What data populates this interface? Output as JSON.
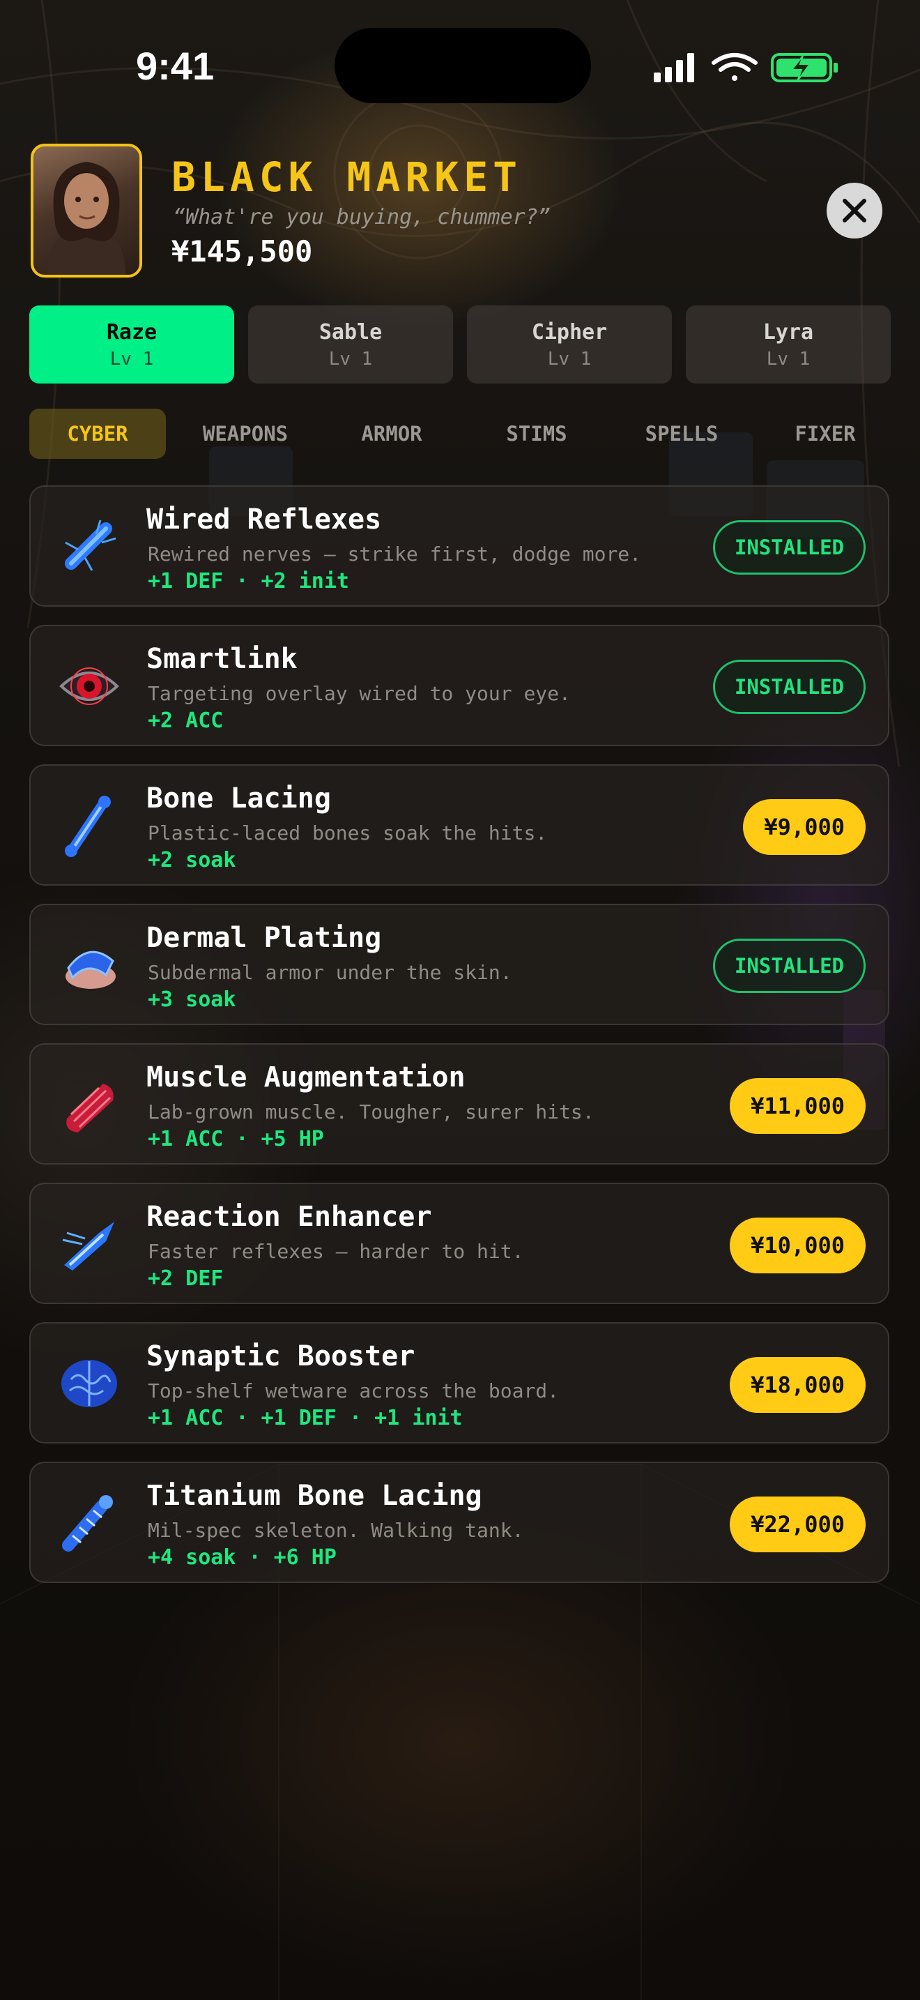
{
  "status_bar": {
    "time": "9:41"
  },
  "header": {
    "title": "BLACK MARKET",
    "quote": "“What're you buying, chummer?”",
    "money": "¥145,500",
    "close_icon": "close-x-icon"
  },
  "characters": [
    {
      "name": "Raze",
      "level": "Lv 1",
      "active": true
    },
    {
      "name": "Sable",
      "level": "Lv 1",
      "active": false
    },
    {
      "name": "Cipher",
      "level": "Lv 1",
      "active": false
    },
    {
      "name": "Lyra",
      "level": "Lv 1",
      "active": false
    }
  ],
  "categories": [
    {
      "label": "CYBER",
      "active": true
    },
    {
      "label": "WEAPONS",
      "active": false
    },
    {
      "label": "ARMOR",
      "active": false
    },
    {
      "label": "STIMS",
      "active": false
    },
    {
      "label": "SPELLS",
      "active": false
    },
    {
      "label": "FIXER",
      "active": false
    }
  ],
  "items": [
    {
      "name": "Wired Reflexes",
      "desc": "Rewired nerves — strike first, dodge more.",
      "stats": "+1 DEF · +2 init",
      "status": "INSTALLED",
      "icon": "wired-reflexes-icon"
    },
    {
      "name": "Smartlink",
      "desc": "Targeting overlay wired to your eye.",
      "stats": "+2 ACC",
      "status": "INSTALLED",
      "icon": "cyber-eye-icon"
    },
    {
      "name": "Bone Lacing",
      "desc": "Plastic-laced bones soak the hits.",
      "stats": "+2 soak",
      "price": "¥9,000",
      "icon": "bone-lacing-icon"
    },
    {
      "name": "Dermal Plating",
      "desc": "Subdermal armor under the skin.",
      "stats": "+3 soak",
      "status": "INSTALLED",
      "icon": "dermal-plating-icon"
    },
    {
      "name": "Muscle Augmentation",
      "desc": "Lab-grown muscle. Tougher, surer hits.",
      "stats": "+1 ACC · +5 HP",
      "price": "¥11,000",
      "icon": "muscle-icon"
    },
    {
      "name": "Reaction Enhancer",
      "desc": "Faster reflexes — harder to hit.",
      "stats": "+2 DEF",
      "price": "¥10,000",
      "icon": "reaction-enhancer-icon"
    },
    {
      "name": "Synaptic Booster",
      "desc": "Top-shelf wetware across the board.",
      "stats": "+1 ACC · +1 DEF · +1 init",
      "price": "¥18,000",
      "icon": "brain-icon"
    },
    {
      "name": "Titanium Bone Lacing",
      "desc": "Mil-spec skeleton. Walking tank.",
      "stats": "+4 soak · +6 HP",
      "price": "¥22,000",
      "icon": "titanium-arm-icon"
    }
  ],
  "colors": {
    "accent_green": "#00ef87",
    "accent_gold": "#f5c518",
    "price_yellow": "#ffcb14"
  }
}
